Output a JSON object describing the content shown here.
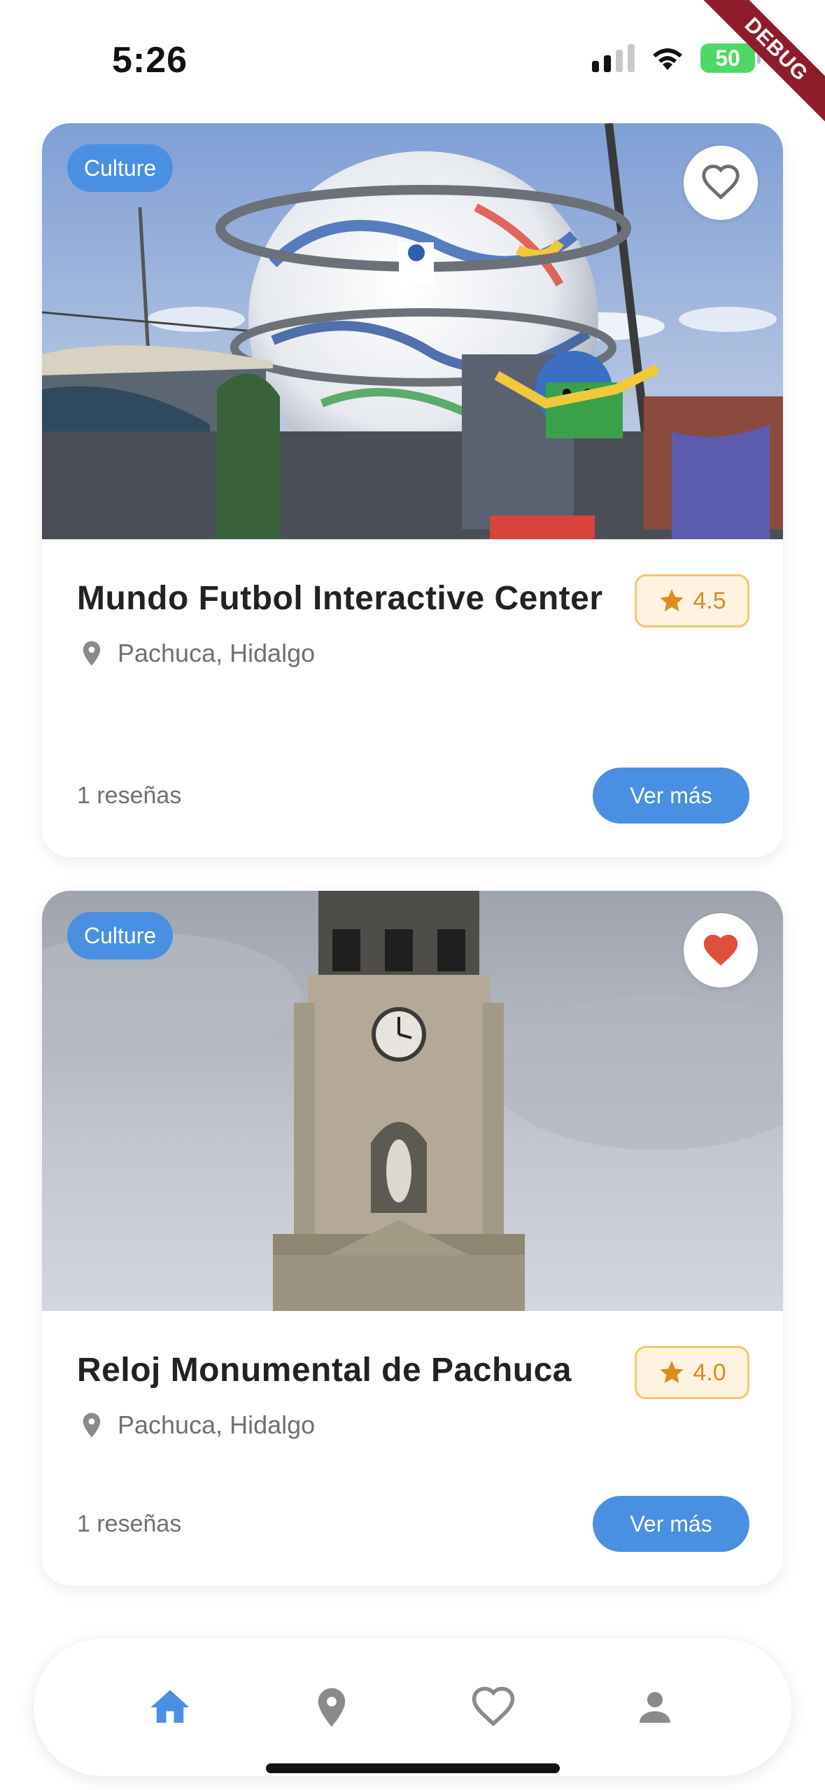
{
  "status_bar": {
    "time": "5:26",
    "battery": "50",
    "debug_label": "DEBUG"
  },
  "colors": {
    "accent": "#4a90e2",
    "favorite_active": "#e04e3c",
    "rating": "#e08a1e",
    "icon_gray": "#8a8a8a"
  },
  "places": [
    {
      "category": "Culture",
      "title": "Mundo Futbol Interactive Center",
      "rating": "4.5",
      "location": "Pachuca, Hidalgo",
      "reviews": "1 reseñas",
      "button_label": "Ver más",
      "favorite": false,
      "image": "Giant soccer ball museum building (Salón de la Fama)"
    },
    {
      "category": "Culture",
      "title": "Reloj Monumental de Pachuca",
      "rating": "4.0",
      "location": "Pachuca, Hidalgo",
      "reviews": "1 reseñas",
      "button_label": "Ver más",
      "favorite": true,
      "image": "Monumental clock tower against cloudy sky"
    }
  ],
  "bottom_nav": {
    "items": [
      {
        "icon": "home-icon",
        "active": true
      },
      {
        "icon": "location-pin-icon",
        "active": false
      },
      {
        "icon": "heart-icon",
        "active": false
      },
      {
        "icon": "person-icon",
        "active": false
      }
    ]
  }
}
